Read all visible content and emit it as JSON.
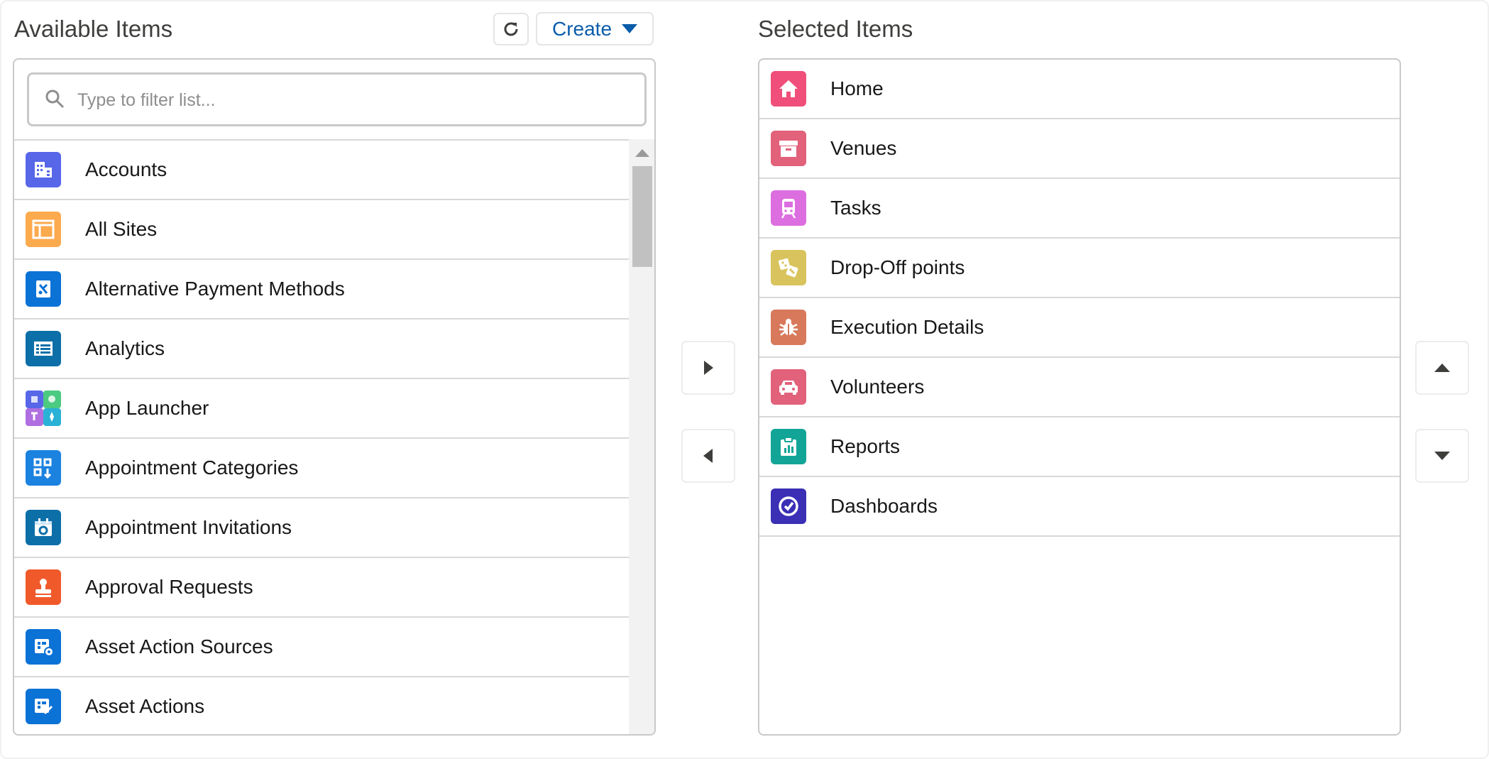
{
  "available": {
    "heading": "Available Items",
    "create_label": "Create",
    "search_placeholder": "Type to filter list...",
    "items": [
      {
        "label": "Accounts",
        "icon": "accounts-icon",
        "color": "#5867e8"
      },
      {
        "label": "All Sites",
        "icon": "all-sites-icon",
        "color": "#fcaa4e"
      },
      {
        "label": "Alternative Payment Methods",
        "icon": "payment-method-icon",
        "color": "#0b72d6"
      },
      {
        "label": "Analytics",
        "icon": "analytics-icon",
        "color": "#0d6fa8"
      },
      {
        "label": "App Launcher",
        "icon": "app-launcher-icon",
        "color": "#6b8fe0"
      },
      {
        "label": "Appointment Categories",
        "icon": "appointment-categories-icon",
        "color": "#1b82e0"
      },
      {
        "label": "Appointment Invitations",
        "icon": "appointment-invitations-icon",
        "color": "#0d6fa8"
      },
      {
        "label": "Approval Requests",
        "icon": "approval-stamp-icon",
        "color": "#f05a2a"
      },
      {
        "label": "Asset Action Sources",
        "icon": "asset-action-source-icon",
        "color": "#0b72d6"
      },
      {
        "label": "Asset Actions",
        "icon": "asset-action-icon",
        "color": "#0b72d6"
      }
    ]
  },
  "selected": {
    "heading": "Selected Items",
    "items": [
      {
        "label": "Home",
        "icon": "home-icon",
        "color": "#ef4f7a"
      },
      {
        "label": "Venues",
        "icon": "venues-archive-icon",
        "color": "#e2617b"
      },
      {
        "label": "Tasks",
        "icon": "tasks-train-icon",
        "color": "#dd6ee0"
      },
      {
        "label": "Drop-Off points",
        "icon": "drop-off-dice-icon",
        "color": "#d8c35c"
      },
      {
        "label": "Execution Details",
        "icon": "execution-bug-icon",
        "color": "#d8795c"
      },
      {
        "label": "Volunteers",
        "icon": "volunteers-car-icon",
        "color": "#e2617b"
      },
      {
        "label": "Reports",
        "icon": "reports-icon",
        "color": "#12a597"
      },
      {
        "label": "Dashboards",
        "icon": "dashboards-icon",
        "color": "#3a2fb5"
      }
    ]
  }
}
